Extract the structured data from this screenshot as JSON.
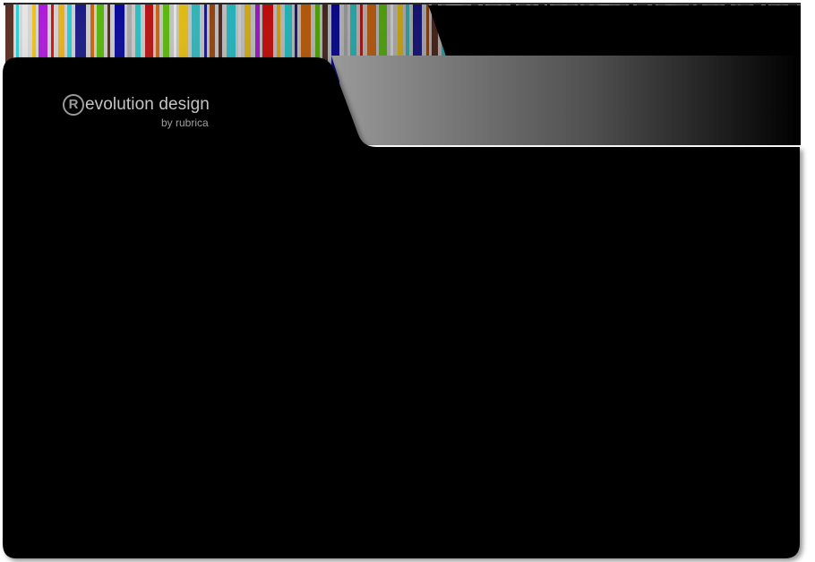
{
  "brand": {
    "mark": "R",
    "name": "evolution design",
    "byline": "by rubrica"
  },
  "theme": {
    "folder_color": "#000000",
    "page_background": "#ffffff",
    "text_primary": "#c4c4c4",
    "text_secondary": "#9e9e9e",
    "stripe_colors": [
      "#5a2e24",
      "#2ccfd8",
      "#e8e8e8",
      "#f2c419",
      "#b21be0",
      "#e10e0e",
      "#f1b71c",
      "#2ad6dc",
      "#1c1c8c",
      "#d96b0d",
      "#5ec20c",
      "#523226",
      "#0a0aa6",
      "#b7b7b7",
      "#2fd0d4",
      "#c91717",
      "#e06f14",
      "#66cc11",
      "#ffffff",
      "#fcd218",
      "#3dcad1",
      "#1a1a96",
      "#a84f15"
    ]
  }
}
